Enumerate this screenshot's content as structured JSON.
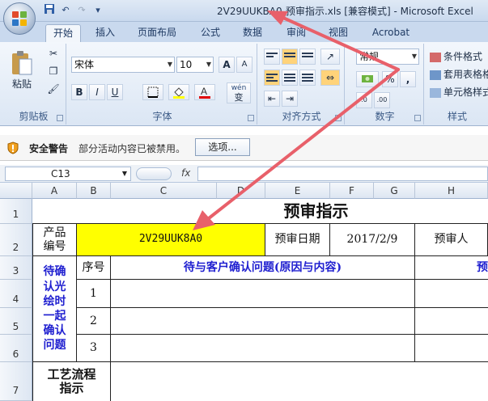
{
  "window": {
    "title": "2V29UUKBA0-预审指示.xls  [兼容模式] - Microsoft Excel",
    "qat_undo": "↶",
    "qat_redo": "↷",
    "qat_more": "▾"
  },
  "ribbon_tabs": [
    "开始",
    "插入",
    "页面布局",
    "公式",
    "数据",
    "审阅",
    "视图",
    "Acrobat"
  ],
  "clipboard": {
    "paste_label": "粘贴",
    "group_label": "剪贴板"
  },
  "font": {
    "name": "宋体",
    "size": "10",
    "bold": "B",
    "italic": "I",
    "underline": "U",
    "grow": "A",
    "shrink": "A",
    "wen": "wén",
    "bian": "变",
    "group_label": "字体"
  },
  "alignment": {
    "group_label": "对齐方式"
  },
  "number": {
    "format": "常规",
    "percent": "%",
    "comma": ",",
    "group_label": "数字"
  },
  "styles": {
    "items": [
      "条件格式",
      "套用表格格",
      "单元格样式"
    ],
    "group_label": "样式"
  },
  "security": {
    "label": "安全警告",
    "message": "部分活动内容已被禁用。",
    "options_button": "选项..."
  },
  "formula_bar": {
    "name_box": "C13",
    "fx": "fx",
    "value": ""
  },
  "columns": [
    "A",
    "B",
    "C",
    "D",
    "E",
    "F",
    "G",
    "H"
  ],
  "rows": [
    "1",
    "2",
    "3",
    "4",
    "5",
    "6",
    "7"
  ],
  "sheet": {
    "title": "预审指示",
    "product_no_label": "产品编号",
    "product_no": "2V29UUK8A0",
    "review_date_label": "预审日期",
    "review_date": "2017/2/9",
    "reviewer_label": "预审人",
    "confirm_label": "待确认光绘时一起确认问题",
    "seq_header": "序号",
    "issue_header": "待与客户确认问题(原因与内容)",
    "right_cut_header": "预",
    "seq": [
      "1",
      "2",
      "3"
    ],
    "process_label": "工艺流程指示"
  },
  "colors": {
    "highlight": "#ffff00",
    "blue_text": "#1f1fd0",
    "arrow": "#e8606a"
  }
}
